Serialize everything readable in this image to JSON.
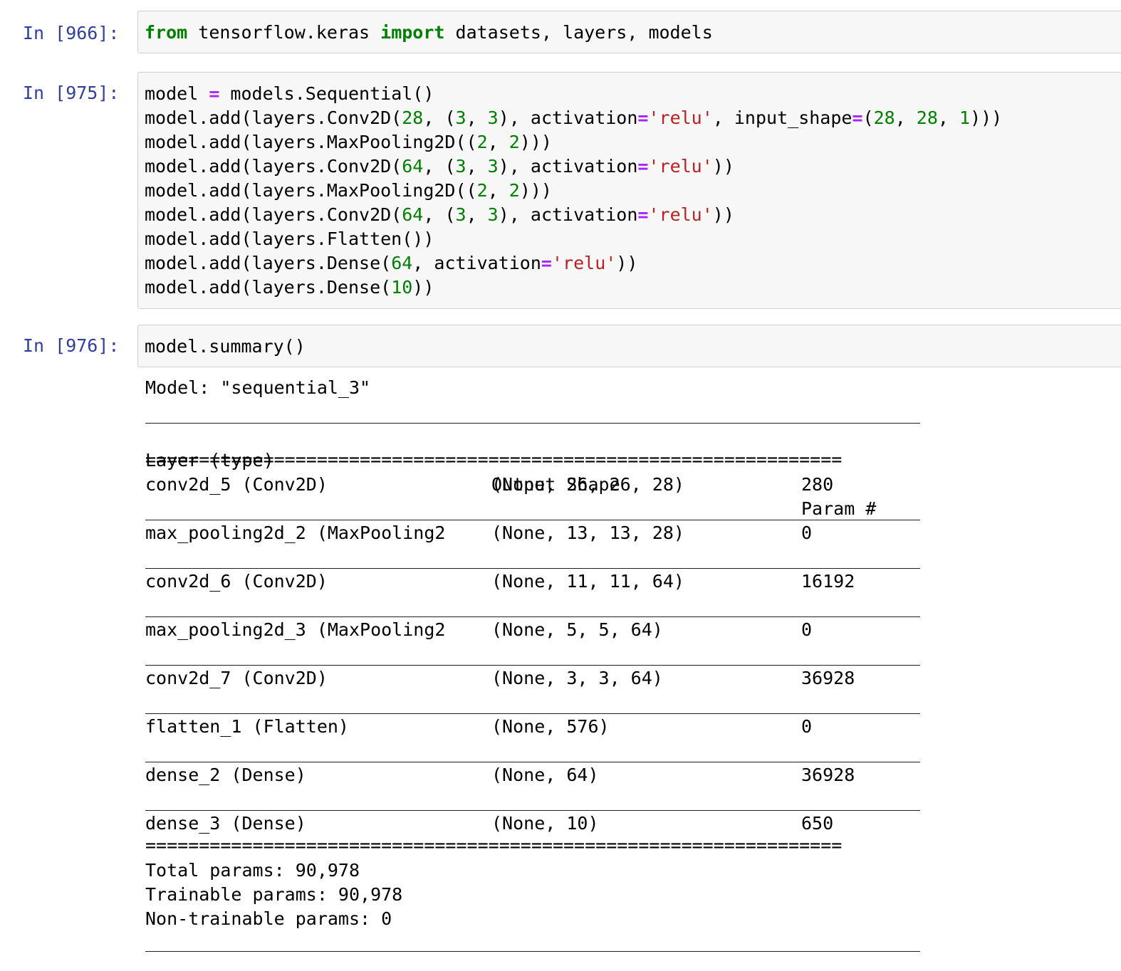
{
  "cells": [
    {
      "prompt": "In [966]:",
      "lines": [
        [
          {
            "t": "from",
            "c": "kw"
          },
          {
            "t": " tensorflow.keras "
          },
          {
            "t": "import",
            "c": "kw"
          },
          {
            "t": " datasets, layers, models"
          }
        ]
      ]
    },
    {
      "prompt": "In [975]:",
      "lines": [
        [
          {
            "t": "model "
          },
          {
            "t": "=",
            "c": "op"
          },
          {
            "t": " models.Sequential()"
          }
        ],
        [
          {
            "t": "model.add(layers.Conv2D("
          },
          {
            "t": "28",
            "c": "num"
          },
          {
            "t": ", ("
          },
          {
            "t": "3",
            "c": "num"
          },
          {
            "t": ", "
          },
          {
            "t": "3",
            "c": "num"
          },
          {
            "t": "), activation"
          },
          {
            "t": "=",
            "c": "op"
          },
          {
            "t": "'relu'",
            "c": "str"
          },
          {
            "t": ", input_shape"
          },
          {
            "t": "=",
            "c": "op"
          },
          {
            "t": "("
          },
          {
            "t": "28",
            "c": "num"
          },
          {
            "t": ", "
          },
          {
            "t": "28",
            "c": "num"
          },
          {
            "t": ", "
          },
          {
            "t": "1",
            "c": "num"
          },
          {
            "t": ")))"
          }
        ],
        [
          {
            "t": "model.add(layers.MaxPooling2D(("
          },
          {
            "t": "2",
            "c": "num"
          },
          {
            "t": ", "
          },
          {
            "t": "2",
            "c": "num"
          },
          {
            "t": ")))"
          }
        ],
        [
          {
            "t": "model.add(layers.Conv2D("
          },
          {
            "t": "64",
            "c": "num"
          },
          {
            "t": ", ("
          },
          {
            "t": "3",
            "c": "num"
          },
          {
            "t": ", "
          },
          {
            "t": "3",
            "c": "num"
          },
          {
            "t": "), activation"
          },
          {
            "t": "=",
            "c": "op"
          },
          {
            "t": "'relu'",
            "c": "str"
          },
          {
            "t": "))"
          }
        ],
        [
          {
            "t": "model.add(layers.MaxPooling2D(("
          },
          {
            "t": "2",
            "c": "num"
          },
          {
            "t": ", "
          },
          {
            "t": "2",
            "c": "num"
          },
          {
            "t": ")))"
          }
        ],
        [
          {
            "t": "model.add(layers.Conv2D("
          },
          {
            "t": "64",
            "c": "num"
          },
          {
            "t": ", ("
          },
          {
            "t": "3",
            "c": "num"
          },
          {
            "t": ", "
          },
          {
            "t": "3",
            "c": "num"
          },
          {
            "t": "), activation"
          },
          {
            "t": "=",
            "c": "op"
          },
          {
            "t": "'relu'",
            "c": "str"
          },
          {
            "t": "))"
          }
        ],
        [
          {
            "t": "model.add(layers.Flatten())"
          }
        ],
        [
          {
            "t": "model.add(layers.Dense("
          },
          {
            "t": "64",
            "c": "num"
          },
          {
            "t": ", activation"
          },
          {
            "t": "=",
            "c": "op"
          },
          {
            "t": "'relu'",
            "c": "str"
          },
          {
            "t": "))"
          }
        ],
        [
          {
            "t": "model.add(layers.Dense("
          },
          {
            "t": "10",
            "c": "num"
          },
          {
            "t": "))"
          }
        ]
      ]
    },
    {
      "prompt": "In [976]:",
      "lines": [
        [
          {
            "t": "model.summary()"
          }
        ]
      ]
    }
  ],
  "summary": {
    "model_line": "Model: \"sequential_3\"",
    "header": {
      "layer": "Layer (type)",
      "shape": "Output Shape",
      "param": "Param #"
    },
    "rows": [
      {
        "layer": "conv2d_5 (Conv2D)",
        "shape": "(None, 26, 26, 28)",
        "param": "280"
      },
      {
        "layer": "max_pooling2d_2 (MaxPooling2",
        "shape": "(None, 13, 13, 28)",
        "param": "0"
      },
      {
        "layer": "conv2d_6 (Conv2D)",
        "shape": "(None, 11, 11, 64)",
        "param": "16192"
      },
      {
        "layer": "max_pooling2d_3 (MaxPooling2",
        "shape": "(None, 5, 5, 64)",
        "param": "0"
      },
      {
        "layer": "conv2d_7 (Conv2D)",
        "shape": "(None, 3, 3, 64)",
        "param": "36928"
      },
      {
        "layer": "flatten_1 (Flatten)",
        "shape": "(None, 576)",
        "param": "0"
      },
      {
        "layer": "dense_2 (Dense)",
        "shape": "(None, 64)",
        "param": "36928"
      },
      {
        "layer": "dense_3 (Dense)",
        "shape": "(None, 10)",
        "param": "650"
      }
    ],
    "total": "Total params: 90,978",
    "trainable": "Trainable params: 90,978",
    "non_trainable": "Non-trainable params: 0"
  }
}
